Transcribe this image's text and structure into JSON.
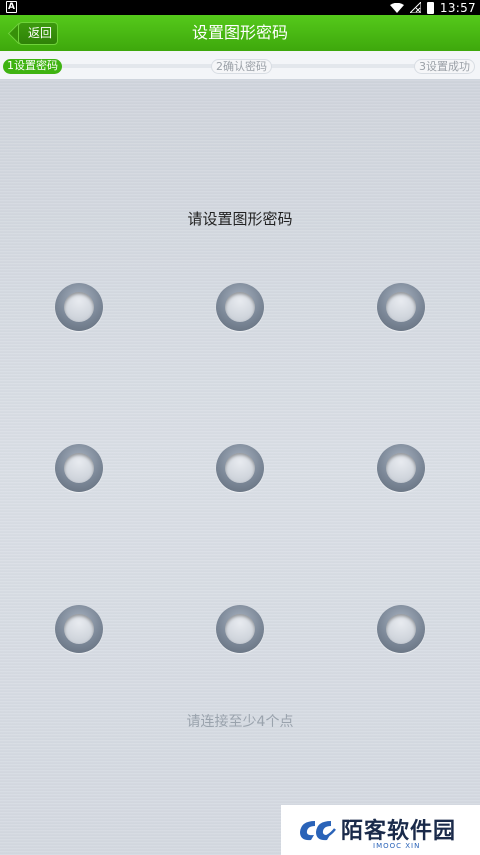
{
  "status_bar": {
    "time": "13:57",
    "notification_letter": "A"
  },
  "header": {
    "back_label": "返回",
    "title": "设置图形密码",
    "accent_color": "#4cbd16"
  },
  "steps": [
    {
      "label": "1设置密码",
      "state": "active"
    },
    {
      "label": "2确认密码",
      "state": "pending"
    },
    {
      "label": "3设置成功",
      "state": "pending"
    }
  ],
  "pattern": {
    "prompt": "请设置图形密码",
    "hint": "请连接至少4个点",
    "dots": [
      "dot-1",
      "dot-2",
      "dot-3",
      "dot-4",
      "dot-5",
      "dot-6",
      "dot-7",
      "dot-8",
      "dot-9"
    ]
  },
  "watermark": {
    "text": "陌客软件园",
    "sub": "IMOOC XIN"
  }
}
